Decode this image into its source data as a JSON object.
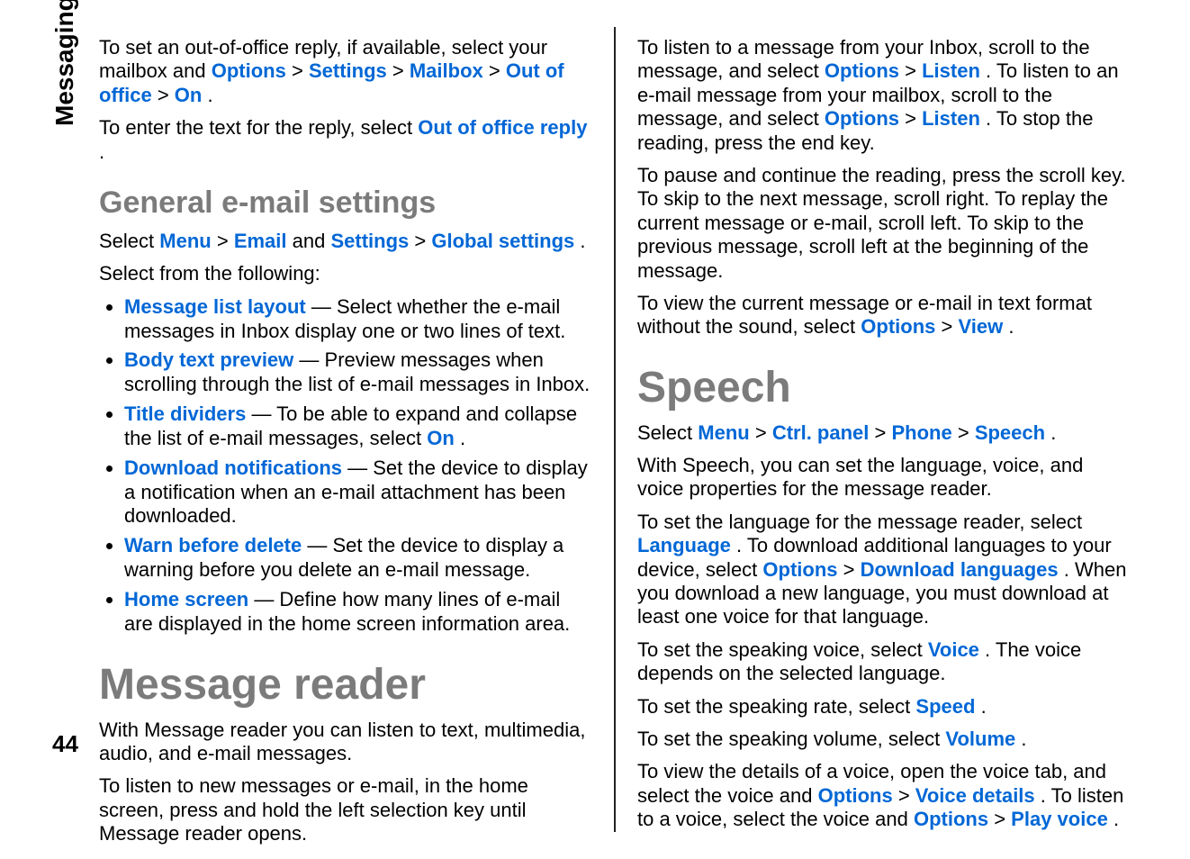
{
  "side_label": "Messaging",
  "page_number": "44",
  "left": {
    "p1_a": "To set an out-of-office reply, if available, select your mailbox and ",
    "p1_opt1": "Options",
    "p1_gt1": " > ",
    "p1_opt2": "Settings",
    "p1_gt2": " > ",
    "p1_opt3": "Mailbox",
    "p1_gt3": " > ",
    "p1_opt4": "Out of office",
    "p1_gt4": " > ",
    "p1_opt5": "On",
    "p1_end": ".",
    "p2_a": "To enter the text for the reply, select ",
    "p2_opt": "Out of office reply",
    "p2_end": ".",
    "h_general": "General e-mail settings",
    "p3_a": "Select ",
    "p3_opt1": "Menu",
    "p3_gt1": " > ",
    "p3_opt2": "Email",
    "p3_mid": " and ",
    "p3_opt3": "Settings",
    "p3_gt2": " > ",
    "p3_opt4": "Global settings",
    "p3_end": ".",
    "p4": "Select from the following:",
    "opts": [
      {
        "name": "Message list layout",
        "desc": " — Select whether the e-mail messages in Inbox display one or two lines of text."
      },
      {
        "name": "Body text preview",
        "desc": " — Preview messages when scrolling through the list of e-mail messages in Inbox."
      },
      {
        "name": "Title dividers",
        "desc_pre": " — To be able to expand and collapse the list of e-mail messages, select ",
        "opt_in": "On",
        "desc_post": "."
      },
      {
        "name": "Download notifications",
        "desc": " — Set the device to display a notification when an e-mail attachment has been downloaded."
      },
      {
        "name": "Warn before delete",
        "desc": " — Set the device to display a warning before you delete an e-mail message."
      },
      {
        "name": "Home screen",
        "desc": " — Define how many lines of e-mail are displayed in the home screen information area."
      }
    ],
    "h_reader": "Message reader",
    "p5": "With Message reader you can listen to text, multimedia, audio, and e-mail messages.",
    "p6": "To listen to new messages or e-mail, in the home screen, press and hold the left selection key until Message reader opens."
  },
  "right": {
    "p1_a": "To listen to a message from your Inbox, scroll to the message, and select ",
    "p1_opt1": "Options",
    "p1_gt1": " > ",
    "p1_opt2": "Listen",
    "p1_mid": ". To listen to an e-mail message from your mailbox, scroll to the message, and select",
    "p1_opt3": "Options",
    "p1_gt2": " > ",
    "p1_opt4": "Listen",
    "p1_end": ". To stop the reading, press the end key.",
    "p2": "To pause and continue the reading, press the scroll key. To skip to the next message, scroll right. To replay the current message or e-mail, scroll left. To skip to the previous message, scroll left at the beginning of the message.",
    "p3_a": "To view the current message or e-mail in text format without the sound, select ",
    "p3_opt1": "Options",
    "p3_gt1": " > ",
    "p3_opt2": "View",
    "p3_end": ".",
    "h_speech": "Speech",
    "p4_a": "Select ",
    "p4_opt1": "Menu",
    "p4_gt1": " > ",
    "p4_opt2": "Ctrl. panel",
    "p4_gt2": " > ",
    "p4_opt3": "Phone",
    "p4_gt3": " > ",
    "p4_opt4": "Speech",
    "p4_end": ".",
    "p5": "With Speech, you can set the language, voice, and voice properties for the message reader.",
    "p6_a": "To set the language for the message reader, select ",
    "p6_opt1": "Language",
    "p6_mid": ". To download additional languages to your device, select ",
    "p6_opt2": "Options",
    "p6_gt1": " > ",
    "p6_opt3": "Download languages",
    "p6_end": ". When you download a new language, you must download at least one voice for that language.",
    "p7_a": "To set the speaking voice, select ",
    "p7_opt": "Voice",
    "p7_end": ". The voice depends on the selected language.",
    "p8_a": "To set the speaking rate, select ",
    "p8_opt": "Speed",
    "p8_end": ".",
    "p9_a": "To set the speaking volume, select ",
    "p9_opt": "Volume",
    "p9_end": ".",
    "p10_a": "To view the details of a voice, open the voice tab, and select the voice and ",
    "p10_opt1": "Options",
    "p10_gt1": " > ",
    "p10_opt2": "Voice details",
    "p10_mid": ". To listen to a voice, select the voice and ",
    "p10_opt3": "Options",
    "p10_gt2": " > ",
    "p10_opt4": "Play voice",
    "p10_end": "."
  }
}
